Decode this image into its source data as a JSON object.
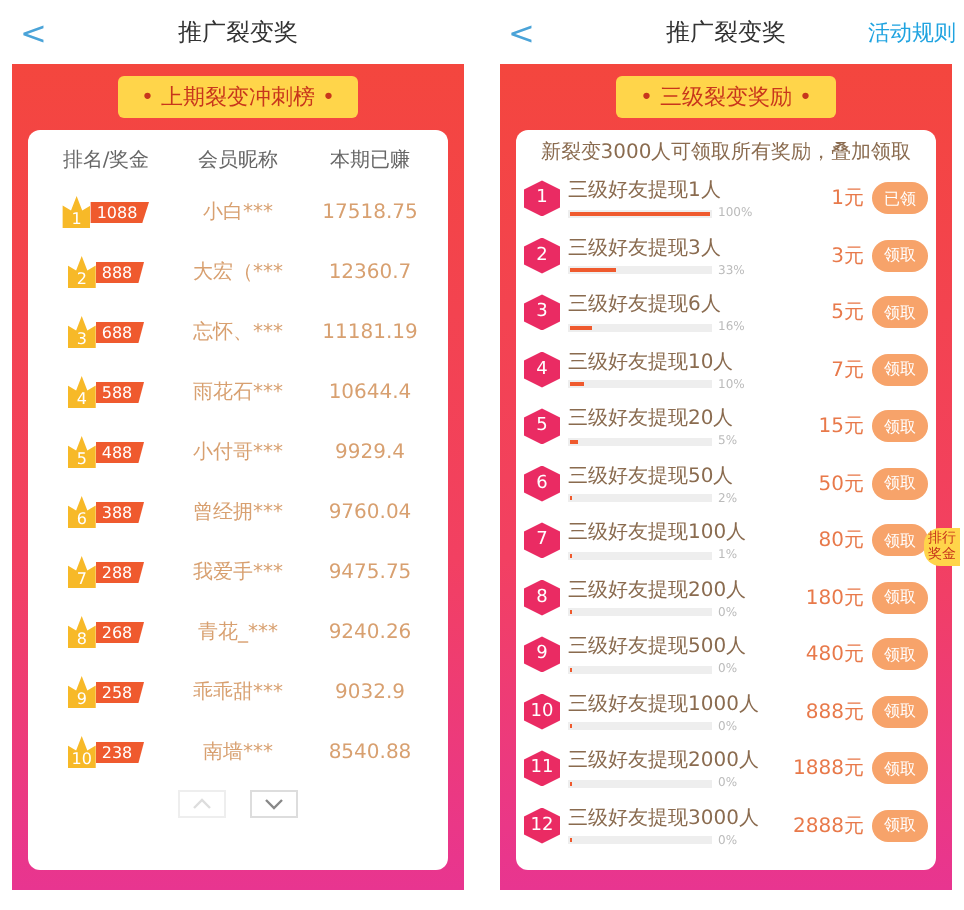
{
  "left": {
    "header": {
      "back": "<",
      "title": "推广裂变奖"
    },
    "banner": "• 上期裂变冲刺榜 •",
    "columns": [
      "排名/奖金",
      "会员昵称",
      "本期已赚"
    ],
    "rows": [
      {
        "rank": "1",
        "prize": "1088",
        "name": "小白***",
        "earned": "17518.75"
      },
      {
        "rank": "2",
        "prize": "888",
        "name": "大宏（***",
        "earned": "12360.7"
      },
      {
        "rank": "3",
        "prize": "688",
        "name": "忘怀、***",
        "earned": "11181.19"
      },
      {
        "rank": "4",
        "prize": "588",
        "name": "雨花石***",
        "earned": "10644.4"
      },
      {
        "rank": "5",
        "prize": "488",
        "name": "小付哥***",
        "earned": "9929.4"
      },
      {
        "rank": "6",
        "prize": "388",
        "name": "曾经拥***",
        "earned": "9760.04"
      },
      {
        "rank": "7",
        "prize": "288",
        "name": "我爱手***",
        "earned": "9475.75"
      },
      {
        "rank": "8",
        "prize": "268",
        "name": "青花_***",
        "earned": "9240.26"
      },
      {
        "rank": "9",
        "prize": "258",
        "name": "乖乖甜***",
        "earned": "9032.9"
      },
      {
        "rank": "10",
        "prize": "238",
        "name": "南墙***",
        "earned": "8540.88"
      }
    ]
  },
  "right": {
    "header": {
      "back": "<",
      "title": "推广裂变奖",
      "link": "活动规则"
    },
    "banner": "• 三级裂变奖励 •",
    "note": "新裂变3000人可领取所有奖励，叠加领取",
    "badge": "排行奖金",
    "tasks": [
      {
        "index": "1",
        "label": "三级好友提现1人",
        "level": 1,
        "percent": "100%",
        "amount": "1元",
        "button": "已领"
      },
      {
        "index": "2",
        "label": "三级好友提现3人",
        "level": 0.33,
        "percent": "33%",
        "amount": "3元",
        "button": "领取"
      },
      {
        "index": "3",
        "label": "三级好友提现6人",
        "level": 0.16,
        "percent": "16%",
        "amount": "5元",
        "button": "领取"
      },
      {
        "index": "4",
        "label": "三级好友提现10人",
        "level": 0.1,
        "percent": "10%",
        "amount": "7元",
        "button": "领取"
      },
      {
        "index": "5",
        "label": "三级好友提现20人",
        "level": 0.05,
        "percent": "5%",
        "amount": "15元",
        "button": "领取"
      },
      {
        "index": "6",
        "label": "三级好友提现50人",
        "level": 0.02,
        "percent": "2%",
        "amount": "50元",
        "button": "领取"
      },
      {
        "index": "7",
        "label": "三级好友提现100人",
        "level": 0.01,
        "percent": "1%",
        "amount": "80元",
        "button": "领取"
      },
      {
        "index": "8",
        "label": "三级好友提现200人",
        "level": 0,
        "percent": "0%",
        "amount": "180元",
        "button": "领取"
      },
      {
        "index": "9",
        "label": "三级好友提现500人",
        "level": 0,
        "percent": "0%",
        "amount": "480元",
        "button": "领取"
      },
      {
        "index": "10",
        "label": "三级好友提现1000人",
        "level": 0,
        "percent": "0%",
        "amount": "888元",
        "button": "领取"
      },
      {
        "index": "11",
        "label": "三级好友提现2000人",
        "level": 0,
        "percent": "0%",
        "amount": "1888元",
        "button": "领取"
      },
      {
        "index": "12",
        "label": "三级好友提现3000人",
        "level": 0,
        "percent": "0%",
        "amount": "2888元",
        "button": "领取"
      }
    ]
  }
}
